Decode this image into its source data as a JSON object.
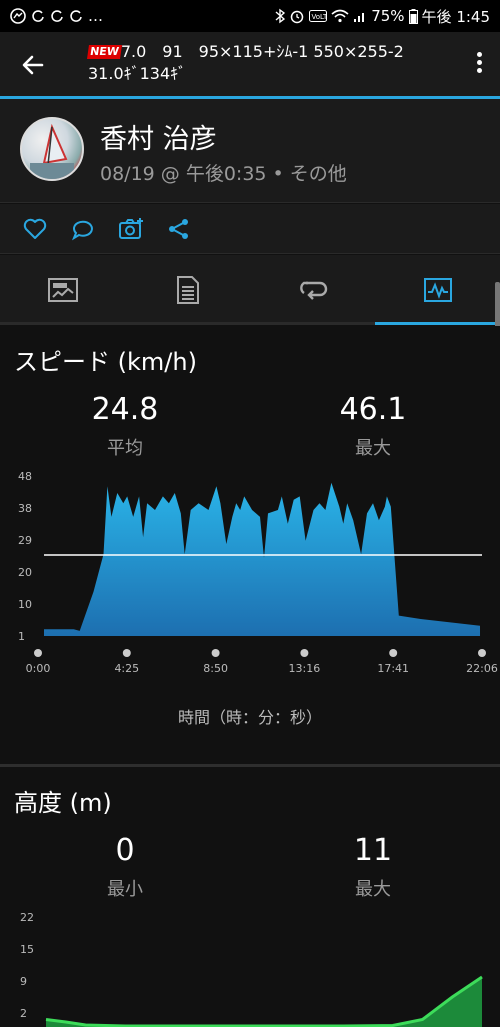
{
  "status_bar": {
    "time": "午後 1:45",
    "battery": "75%",
    "left_icons": [
      "messenger-icon",
      "loop-icon",
      "loop-icon",
      "loop-icon",
      "more-icon"
    ]
  },
  "header": {
    "badge": "NEW",
    "title_line1": "7.0　91　95×115+ｼﾑ-1 550×255-2",
    "title_line2": "31.0ｷﾞ134ｷﾞ"
  },
  "profile": {
    "name": "香村 治彦",
    "meta": "08/19 @ 午後0:35 • その他"
  },
  "colors": {
    "accent": "#2aa7e0",
    "background": "#111111",
    "panel": "#1b1b1b"
  },
  "tabs": [
    {
      "icon": "summary-icon"
    },
    {
      "icon": "details-icon"
    },
    {
      "icon": "laps-icon"
    },
    {
      "icon": "charts-icon",
      "active": true
    }
  ],
  "speed": {
    "title": "スピード (km/h)",
    "avg_value": "24.8",
    "avg_label": "平均",
    "max_value": "46.1",
    "max_label": "最大",
    "x_axis_label": "時間（時：分：秒）"
  },
  "altitude": {
    "title": "高度 (m)",
    "min_value": "0",
    "min_label": "最小",
    "max_value": "11",
    "max_label": "最大"
  },
  "chart_data": [
    {
      "type": "area",
      "name": "speed",
      "y_ticks": [
        "48",
        "38",
        "29",
        "20",
        "10",
        "1"
      ],
      "x_ticks": [
        "0:00",
        "4:25",
        "8:50",
        "13:16",
        "17:41",
        "22:06"
      ],
      "ylim": [
        1,
        48
      ],
      "xlim_minutes": [
        0,
        22.1
      ],
      "average_line": 24.8,
      "x": [
        0,
        1.5,
        1.8,
        2.5,
        3.0,
        3.2,
        3.4,
        3.7,
        4.0,
        4.2,
        4.5,
        4.8,
        5.0,
        5.2,
        5.6,
        6.0,
        6.3,
        6.6,
        6.9,
        7.1,
        7.4,
        7.8,
        8.3,
        8.7,
        8.9,
        9.2,
        9.5,
        9.7,
        9.9,
        10.1,
        10.5,
        10.9,
        11.1,
        11.3,
        11.8,
        12.0,
        12.3,
        12.6,
        12.9,
        13.2,
        13.6,
        13.9,
        14.2,
        14.5,
        14.9,
        15.1,
        15.3,
        15.6,
        16.0,
        16.3,
        16.6,
        16.9,
        17.2,
        17.3,
        17.5,
        17.9,
        19.0,
        20.5,
        22.0
      ],
      "y": [
        3,
        3,
        2.5,
        14,
        25,
        45,
        36,
        43,
        40,
        42,
        36,
        42,
        30,
        40,
        38,
        42,
        40,
        43,
        37,
        25,
        38,
        40,
        38,
        45,
        40,
        28,
        36,
        40,
        38,
        42,
        38,
        36,
        24,
        37,
        38,
        42,
        34,
        41,
        42,
        29,
        38,
        40,
        38,
        46,
        39,
        34,
        40,
        35,
        25,
        37,
        40,
        35,
        39,
        42,
        39,
        7,
        6,
        5,
        4
      ]
    },
    {
      "type": "area",
      "name": "altitude",
      "y_ticks": [
        "22",
        "15",
        "9",
        "2"
      ],
      "ylim": [
        0,
        22
      ],
      "x": [
        0,
        1.0,
        2.0,
        4.0,
        8.0,
        12.0,
        15.0,
        17.5,
        19.0,
        20.5,
        22.0
      ],
      "y": [
        1.5,
        1.0,
        0.4,
        0.2,
        0.2,
        0.2,
        0.2,
        0.3,
        1.5,
        6,
        10
      ]
    }
  ]
}
